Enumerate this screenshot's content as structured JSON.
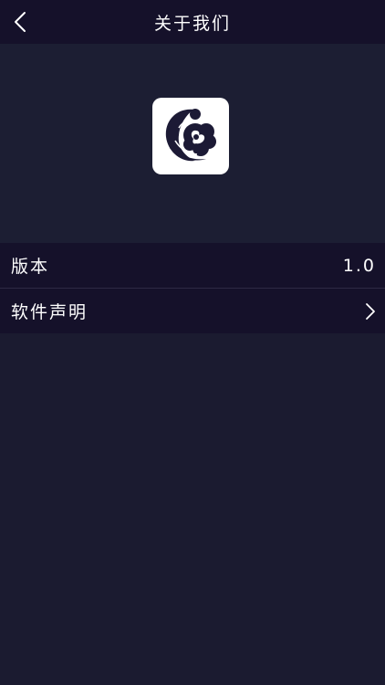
{
  "navbar": {
    "title": "关于我们",
    "back_icon": "chevron-left-icon"
  },
  "app": {
    "logo_icon": "app-logo-icon"
  },
  "settings": {
    "version": {
      "label": "版本",
      "value": "1.0"
    },
    "statement": {
      "label": "软件声明",
      "icon": "chevron-right-icon"
    }
  },
  "colors": {
    "background": "#1b1b30",
    "bar": "#15112a",
    "text": "#ffffff"
  }
}
